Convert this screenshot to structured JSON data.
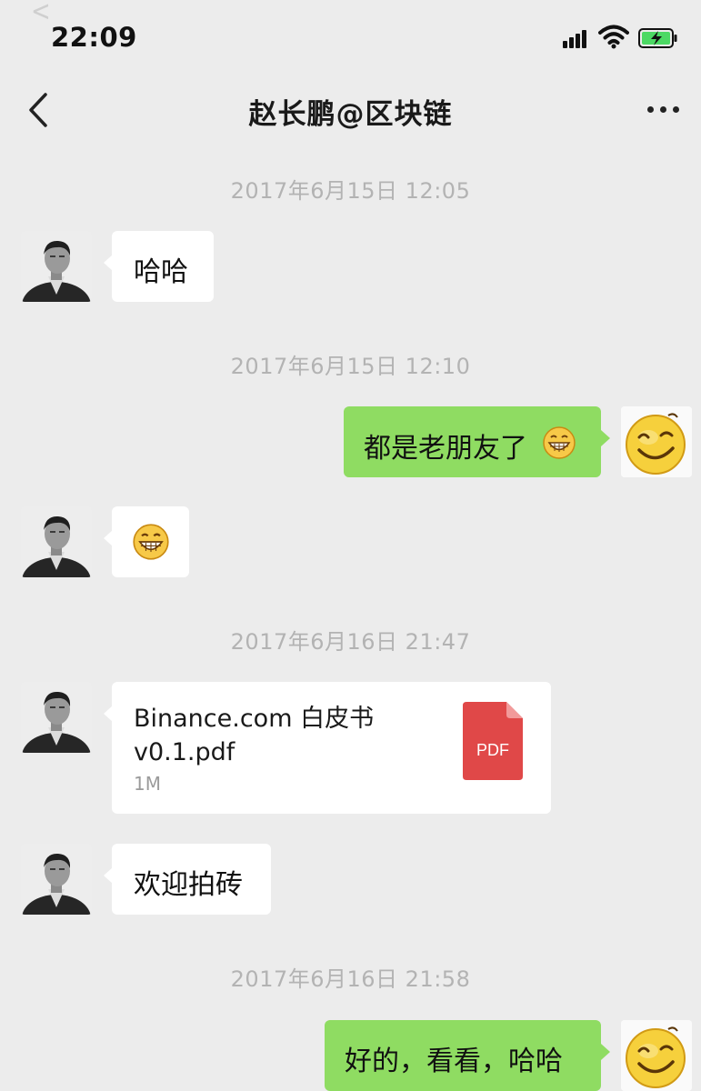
{
  "status_bar": {
    "time": "22:09",
    "back_hint_glyph": "<"
  },
  "nav": {
    "title": "赵长鹏@区块链",
    "back_icon": "chevron-left-icon",
    "more_icon": "more-dots-icon"
  },
  "messages": [
    {
      "type": "timestamp",
      "text": "2017年6月15日 12:05"
    },
    {
      "type": "text",
      "direction": "incoming",
      "text": "哈哈"
    },
    {
      "type": "timestamp",
      "text": "2017年6月15日 12:10"
    },
    {
      "type": "text",
      "direction": "outgoing",
      "text": "都是老朋友了",
      "emoji": "grin-emoji"
    },
    {
      "type": "emoji",
      "direction": "incoming",
      "emoji": "grin-emoji"
    },
    {
      "type": "timestamp",
      "text": "2017年6月16日 21:47"
    },
    {
      "type": "file",
      "direction": "incoming",
      "file_name": "Binance.com 白皮书 v0.1.pdf",
      "file_size": "1M",
      "file_icon_label": "PDF"
    },
    {
      "type": "text",
      "direction": "incoming",
      "text": "欢迎拍砖"
    },
    {
      "type": "timestamp",
      "text": "2017年6月16日 21:58"
    },
    {
      "type": "text",
      "direction": "outgoing",
      "text": "好的，看看，哈哈"
    }
  ],
  "colors": {
    "background": "#ececec",
    "outgoing_bubble": "#8fdc62",
    "incoming_bubble": "#ffffff",
    "timestamp_text": "#b3b3b3",
    "pdf_icon": "#e04848",
    "battery_fill": "#4cd964"
  }
}
